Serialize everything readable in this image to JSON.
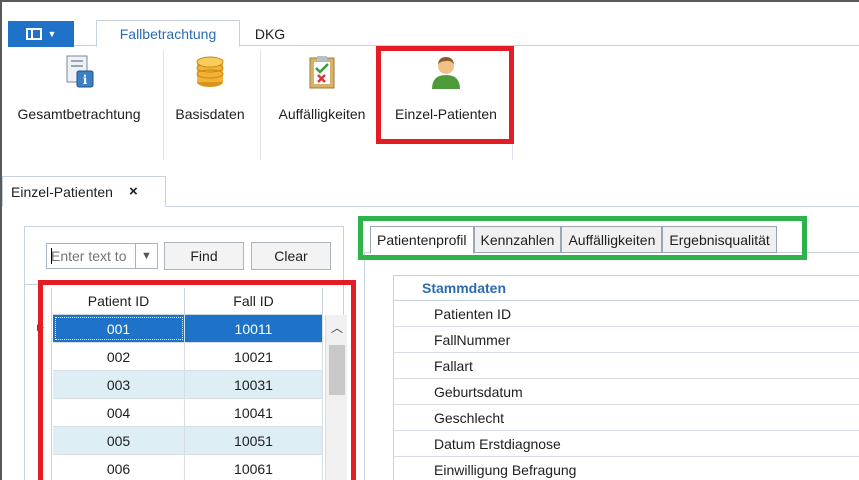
{
  "ribbon": {
    "tabs": [
      {
        "label": "Fallbetrachtung",
        "active": true
      },
      {
        "label": "DKG",
        "active": false
      }
    ],
    "buttons": [
      {
        "label": "Gesamtbetrachtung",
        "icon": "info-document-icon"
      },
      {
        "label": "Basisdaten",
        "icon": "database-icon"
      },
      {
        "label": "Auffälligkeiten",
        "icon": "clipboard-check-icon"
      },
      {
        "label": "Einzel-Patienten",
        "icon": "person-icon"
      }
    ]
  },
  "doc_tab": {
    "label": "Einzel-Patienten",
    "close": "×"
  },
  "filter": {
    "placeholder": "Enter text to",
    "find_label": "Find",
    "clear_label": "Clear"
  },
  "grid": {
    "columns": [
      "Patient ID",
      "Fall ID"
    ],
    "rows": [
      {
        "patient_id": "001",
        "fall_id": "10011",
        "selected": true
      },
      {
        "patient_id": "002",
        "fall_id": "10021"
      },
      {
        "patient_id": "003",
        "fall_id": "10031"
      },
      {
        "patient_id": "004",
        "fall_id": "10041"
      },
      {
        "patient_id": "005",
        "fall_id": "10051"
      },
      {
        "patient_id": "006",
        "fall_id": "10061"
      }
    ]
  },
  "detail_tabs": [
    {
      "label": "Patientenprofil",
      "active": true
    },
    {
      "label": "Kennzahlen"
    },
    {
      "label": "Auffälligkeiten"
    },
    {
      "label": "Ergebnisqualität"
    }
  ],
  "properties": {
    "section": "Stammdaten",
    "rows": [
      "Patienten ID",
      "FallNummer",
      "Fallart",
      "Geburtsdatum",
      "Geschlecht",
      "Datum Erstdiagnose",
      "Einwilligung Befragung"
    ]
  },
  "colors": {
    "accent": "#1e73c8",
    "highlight_red": "#e41c23",
    "highlight_green": "#2db34a",
    "row_alt": "#ddeef5"
  }
}
